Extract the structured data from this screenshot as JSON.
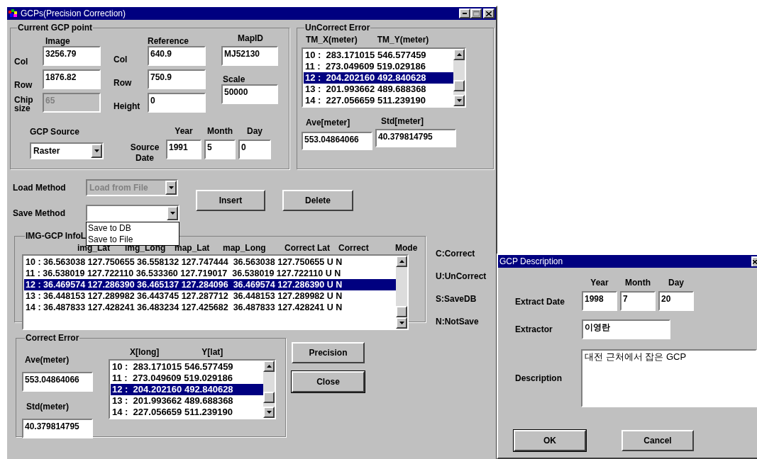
{
  "window": {
    "title": "GCPs(Precision Correction)"
  },
  "current_gcp": {
    "title": "Current GCP point",
    "image": {
      "heading": "Image",
      "fields": [
        {
          "label": "Col",
          "value": "3256.79",
          "disabled": false
        },
        {
          "label": "Row",
          "value": "1876.82",
          "disabled": false
        },
        {
          "label": "Chip size",
          "value": "65",
          "disabled": true
        }
      ]
    },
    "reference": {
      "heading": "Reference",
      "fields": [
        {
          "label": "Col",
          "value": "640.9",
          "disabled": false
        },
        {
          "label": "Row",
          "value": "750.9",
          "disabled": false
        },
        {
          "label": "Height",
          "value": "0",
          "disabled": false
        }
      ]
    },
    "map_id": {
      "label": "MapID",
      "value": "MJ52130"
    },
    "scale": {
      "label": "Scale",
      "value": "50000"
    },
    "gcp_source": {
      "label": "GCP Source",
      "value": "Raster"
    },
    "source_date": {
      "label": "Source Date",
      "columns": [
        "Year",
        "Month",
        "Day"
      ],
      "values": [
        "1991",
        "5",
        "0"
      ]
    }
  },
  "uncorrect_error": {
    "title": "UnCorrect Error",
    "columns": [
      "TM_X(meter)",
      "TM_Y(meter)"
    ],
    "rows": [
      {
        "text": "10 :  283.171015 546.577459",
        "selected": false
      },
      {
        "text": "11 :  273.049609 519.029186",
        "selected": false
      },
      {
        "text": "12 :  204.202160 492.840628",
        "selected": true
      },
      {
        "text": "13 :  201.993662 489.688368",
        "selected": false
      },
      {
        "text": "14 :  227.056659 511.239190",
        "selected": false
      }
    ],
    "ave": {
      "label": "Ave[meter]",
      "value": "553.04864066"
    },
    "std": {
      "label": "Std[meter]",
      "value": "40.379814795"
    }
  },
  "load_method": {
    "label": "Load Method",
    "value": "Load from File",
    "disabled": true
  },
  "save_method": {
    "label": "Save Method",
    "expanded": true,
    "options": [
      "Save to DB",
      "Save to File"
    ]
  },
  "edit_buttons": [
    "Insert",
    "Delete"
  ],
  "img_gcp_info": {
    "title": "IMG-GCP InfoL",
    "columns": [
      "img_Lat",
      "img_Long",
      "map_Lat",
      "map_Long",
      "Correct Lat",
      "Correct",
      "Mode"
    ],
    "rows": [
      {
        "text": "10 : 36.563038 127.750655 36.558132 127.747444  36.563038 127.750655 U N",
        "selected": false
      },
      {
        "text": "11 : 36.538019 127.722110 36.533360 127.719017  36.538019 127.722110 U N",
        "selected": false
      },
      {
        "text": "12 : 36.469574 127.286390 36.465137 127.284096  36.469574 127.286390 U N",
        "selected": true
      },
      {
        "text": "13 : 36.448153 127.289982 36.443745 127.287712  36.448153 127.289982 U N",
        "selected": false
      },
      {
        "text": "14 : 36.487833 127.428241 36.483234 127.425682  36.487833 127.428241 U N",
        "selected": false
      }
    ]
  },
  "legend": [
    "C:Correct",
    "U:UnCorrect",
    "S:SaveDB",
    "N:NotSave"
  ],
  "correct_error": {
    "title": "Correct Error",
    "ave": {
      "label": "Ave(meter)",
      "value": "553.04864066"
    },
    "std": {
      "label": "Std(meter)",
      "value": "40.379814795"
    },
    "columns": [
      "X[long]",
      "Y[lat]"
    ],
    "rows": [
      {
        "text": "10 :  283.171015 546.577459",
        "selected": false
      },
      {
        "text": "11 :  273.049609 519.029186",
        "selected": false
      },
      {
        "text": "12 :  204.202160 492.840628",
        "selected": true
      },
      {
        "text": "13 :  201.993662 489.688368",
        "selected": false
      },
      {
        "text": "14 :  227.056659 511.239190",
        "selected": false
      }
    ]
  },
  "action_buttons": [
    "Precision",
    "Close"
  ],
  "description_dialog": {
    "title": "GCP Description",
    "extract_date": {
      "label": "Extract Date",
      "columns": [
        "Year",
        "Month",
        "Day"
      ],
      "values": [
        "1998",
        "7",
        "20"
      ]
    },
    "extractor": {
      "label": "Extractor",
      "value": "이영란"
    },
    "description": {
      "label": "Description",
      "value": "대전 근처에서 잡은 GCP"
    },
    "buttons": [
      "OK",
      "Cancel"
    ]
  }
}
